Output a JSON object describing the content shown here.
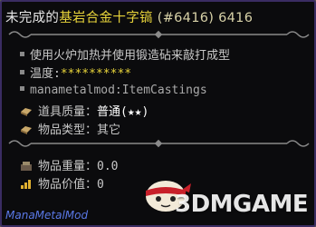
{
  "tooltip": {
    "title_prefix": "未完成的",
    "item_name": "基岩合金十字镐",
    "item_id": "(#6416)",
    "item_damage": "6416",
    "lines": {
      "forging_hint": "使用火炉加热并使用锻造砧来敲打成型",
      "temperature_label": "温度:",
      "temperature_value": "**********",
      "registry_name": "manametalmod:ItemCastings",
      "quality_label": "道具质量：",
      "quality_value": "普通(★★)",
      "type_label": "物品类型：",
      "type_value": "其它",
      "weight_label": "物品重量：",
      "weight_value": "0.0",
      "price_label": "物品价值：",
      "price_value": "0"
    },
    "mod_name": "ManaMetalMod"
  },
  "watermark": {
    "text": "3DMGAME"
  },
  "colors": {
    "item_name": "#e8d43a",
    "body_text": "#c8c8c8",
    "mod_name": "#5a78e6",
    "border": "#3a2c62",
    "background": "#0b0b0d"
  }
}
